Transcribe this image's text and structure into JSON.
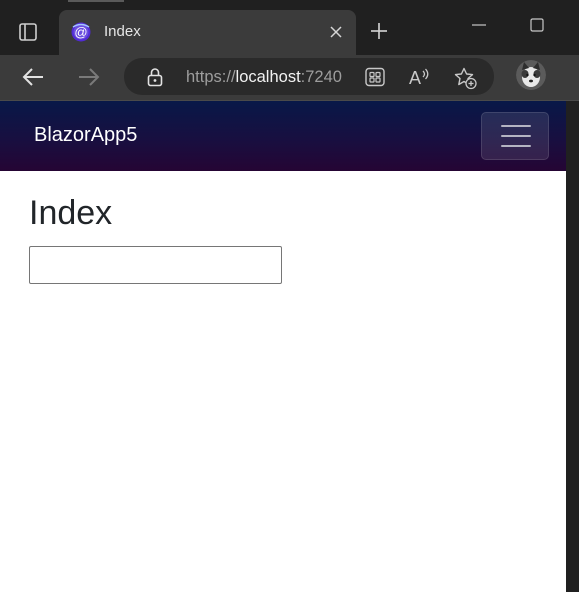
{
  "browser": {
    "tab": {
      "title": "Index",
      "favicon": "blazor-icon"
    },
    "toolbar": {
      "url_scheme": "https://",
      "url_host": "localhost",
      "url_port": ":7240"
    }
  },
  "page": {
    "navbar": {
      "brand": "BlazorApp5",
      "toggler_icon": "hamburger-icon"
    },
    "title": "Index",
    "input": {
      "value": "",
      "placeholder": ""
    }
  },
  "colors": {
    "navbar_top": "#081848",
    "navbar_bottom": "#250534",
    "browser_chrome": "#3b3b3b",
    "tabstrip": "#202020"
  }
}
